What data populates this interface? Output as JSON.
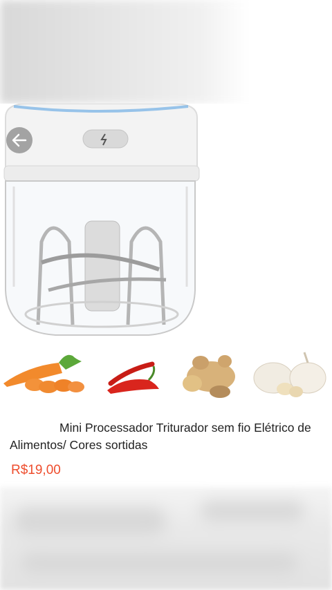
{
  "product": {
    "title": "Mini Processador Triturador sem fio Elétrico de Alimentos/ Cores sortidas",
    "price": "R$19,00"
  },
  "icons": {
    "back": "arrow-left-icon",
    "power": "lightning-icon"
  },
  "ingredients": [
    "carrot",
    "chili-pepper",
    "ginger",
    "garlic"
  ],
  "colors": {
    "price": "#ee4d2d",
    "text": "#222222",
    "accent_blue": "#7fb6e6"
  }
}
